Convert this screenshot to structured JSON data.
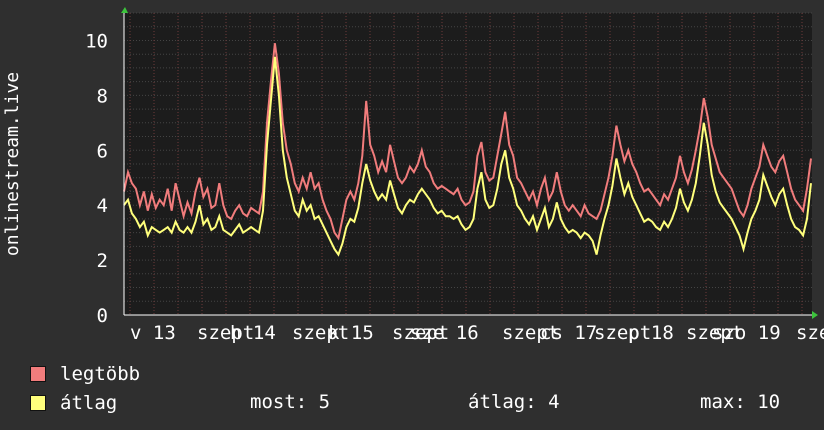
{
  "chart_data": {
    "type": "line",
    "ylabel": "onlinestream.live",
    "ylim": [
      0,
      11
    ],
    "yticks": [
      0,
      2,
      4,
      6,
      8,
      10
    ],
    "x_tick_labels": [
      "v 13",
      "szept",
      "h 14",
      "szept",
      "k 15",
      "szept",
      "sze 16",
      "szept",
      "cs 17",
      "szept",
      "p 18",
      "szept",
      "szo 19",
      "szept"
    ],
    "grid": true,
    "colors": {
      "background": "#2f2f2f",
      "plot": "#1c1c1c",
      "legtobb": "#f17c7c",
      "atlag": "#ffff7c"
    },
    "series": [
      {
        "name": "legtöbb",
        "values": [
          4.5,
          5.2,
          4.8,
          4.6,
          4.0,
          4.5,
          3.8,
          4.4,
          3.9,
          4.2,
          4.0,
          4.6,
          3.8,
          4.8,
          4.2,
          3.6,
          4.1,
          3.7,
          4.5,
          5.0,
          4.3,
          4.6,
          3.9,
          4.0,
          4.8,
          4.0,
          3.6,
          3.5,
          3.8,
          4.0,
          3.7,
          3.6,
          3.9,
          3.8,
          3.7,
          4.5,
          7.0,
          8.5,
          9.9,
          8.8,
          7.0,
          6.0,
          5.5,
          4.8,
          4.5,
          5.0,
          4.6,
          5.2,
          4.6,
          4.8,
          4.2,
          3.8,
          3.5,
          3.0,
          2.8,
          3.5,
          4.2,
          4.5,
          4.2,
          4.8,
          5.8,
          7.8,
          6.2,
          5.8,
          5.2,
          5.6,
          5.2,
          6.2,
          5.6,
          5.0,
          4.8,
          5.0,
          5.4,
          5.2,
          5.5,
          6.0,
          5.4,
          5.2,
          4.8,
          4.6,
          4.7,
          4.6,
          4.5,
          4.4,
          4.6,
          4.2,
          4.0,
          4.1,
          4.5,
          5.8,
          6.3,
          5.2,
          4.9,
          5.0,
          5.8,
          6.6,
          7.4,
          6.2,
          5.8,
          5.0,
          4.8,
          4.5,
          4.2,
          4.5,
          4.0,
          4.6,
          5.0,
          4.2,
          4.5,
          5.2,
          4.5,
          4.0,
          3.8,
          4.0,
          3.8,
          3.6,
          4.0,
          3.7,
          3.6,
          3.5,
          3.8,
          4.4,
          5.0,
          5.8,
          6.9,
          6.2,
          5.6,
          6.0,
          5.5,
          5.2,
          4.8,
          4.5,
          4.6,
          4.4,
          4.2,
          4.0,
          4.4,
          4.2,
          4.6,
          5.0,
          5.8,
          5.2,
          4.8,
          5.3,
          6.0,
          6.8,
          7.9,
          7.2,
          6.2,
          5.7,
          5.2,
          5.0,
          4.8,
          4.6,
          4.2,
          3.8,
          3.6,
          4.0,
          4.6,
          5.0,
          5.4,
          6.2,
          5.8,
          5.4,
          5.2,
          5.6,
          5.8,
          5.2,
          4.6,
          4.2,
          4.0,
          3.8,
          4.6,
          5.7
        ]
      },
      {
        "name": "átlag",
        "values": [
          4.0,
          4.2,
          3.7,
          3.5,
          3.2,
          3.4,
          2.9,
          3.2,
          3.1,
          3.0,
          3.1,
          3.2,
          3.0,
          3.4,
          3.1,
          3.0,
          3.2,
          3.0,
          3.4,
          4.0,
          3.3,
          3.5,
          3.1,
          3.2,
          3.6,
          3.1,
          3.0,
          2.9,
          3.1,
          3.3,
          3.0,
          3.1,
          3.2,
          3.1,
          3.0,
          3.8,
          6.2,
          7.8,
          9.4,
          8.0,
          6.0,
          5.0,
          4.4,
          3.8,
          3.6,
          4.2,
          3.8,
          4.0,
          3.5,
          3.6,
          3.3,
          3.0,
          2.7,
          2.4,
          2.2,
          2.6,
          3.2,
          3.5,
          3.4,
          3.9,
          4.8,
          5.5,
          4.9,
          4.5,
          4.2,
          4.4,
          4.2,
          4.9,
          4.4,
          3.9,
          3.7,
          4.0,
          4.2,
          4.1,
          4.4,
          4.6,
          4.4,
          4.2,
          3.9,
          3.7,
          3.8,
          3.6,
          3.6,
          3.5,
          3.6,
          3.3,
          3.1,
          3.2,
          3.5,
          4.6,
          5.2,
          4.2,
          3.9,
          4.0,
          4.6,
          5.5,
          6.0,
          5.0,
          4.6,
          4.0,
          3.8,
          3.5,
          3.3,
          3.6,
          3.1,
          3.5,
          3.9,
          3.2,
          3.5,
          4.1,
          3.5,
          3.2,
          3.0,
          3.1,
          3.0,
          2.8,
          3.0,
          2.9,
          2.7,
          2.2,
          2.9,
          3.5,
          4.0,
          4.7,
          5.7,
          5.0,
          4.4,
          4.8,
          4.3,
          4.0,
          3.7,
          3.4,
          3.5,
          3.4,
          3.2,
          3.1,
          3.4,
          3.2,
          3.5,
          3.9,
          4.6,
          4.1,
          3.8,
          4.2,
          4.8,
          5.8,
          7.0,
          6.2,
          5.1,
          4.5,
          4.1,
          3.9,
          3.7,
          3.5,
          3.2,
          2.9,
          2.4,
          3.0,
          3.5,
          3.8,
          4.2,
          5.1,
          4.7,
          4.3,
          4.0,
          4.4,
          4.6,
          4.0,
          3.5,
          3.2,
          3.1,
          2.9,
          3.5,
          4.8
        ]
      }
    ]
  },
  "legend": {
    "items": [
      {
        "label": "legtöbb",
        "color": "#f17c7c"
      },
      {
        "label": "átlag",
        "color": "#ffff7c"
      }
    ]
  },
  "stats": {
    "most": "most: 5",
    "atlag": "átlag: 4",
    "max": "max: 10"
  }
}
